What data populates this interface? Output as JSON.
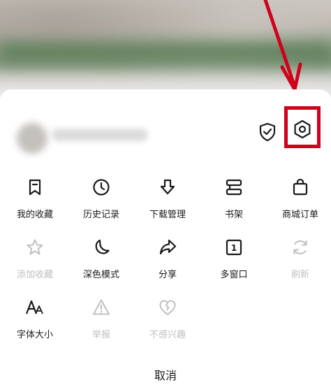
{
  "colors": {
    "icon": "#1a1a1a",
    "disabled": "#c0c0c0",
    "highlight": "#d0021b"
  },
  "header": {
    "shield_icon": "shield-check-icon",
    "settings_icon": "settings-hexagon-icon"
  },
  "menu": {
    "items": [
      {
        "label": "我的收藏",
        "icon": "bookmark-icon",
        "enabled": true
      },
      {
        "label": "历史记录",
        "icon": "clock-icon",
        "enabled": true
      },
      {
        "label": "下载管理",
        "icon": "download-icon",
        "enabled": true
      },
      {
        "label": "书架",
        "icon": "bookshelf-icon",
        "enabled": true
      },
      {
        "label": "商城订单",
        "icon": "shopping-bag-icon",
        "enabled": true
      },
      {
        "label": "添加收藏",
        "icon": "star-icon",
        "enabled": false
      },
      {
        "label": "深色模式",
        "icon": "moon-icon",
        "enabled": true
      },
      {
        "label": "分享",
        "icon": "share-arrow-icon",
        "enabled": true
      },
      {
        "label": "多窗口",
        "icon": "window-count-icon",
        "enabled": true,
        "badge": "1"
      },
      {
        "label": "刷新",
        "icon": "refresh-icon",
        "enabled": false
      },
      {
        "label": "字体大小",
        "icon": "font-size-icon",
        "enabled": true
      },
      {
        "label": "举报",
        "icon": "warning-icon",
        "enabled": false
      },
      {
        "label": "不感兴趣",
        "icon": "broken-heart-icon",
        "enabled": false
      }
    ]
  },
  "cancel_label": "取消"
}
